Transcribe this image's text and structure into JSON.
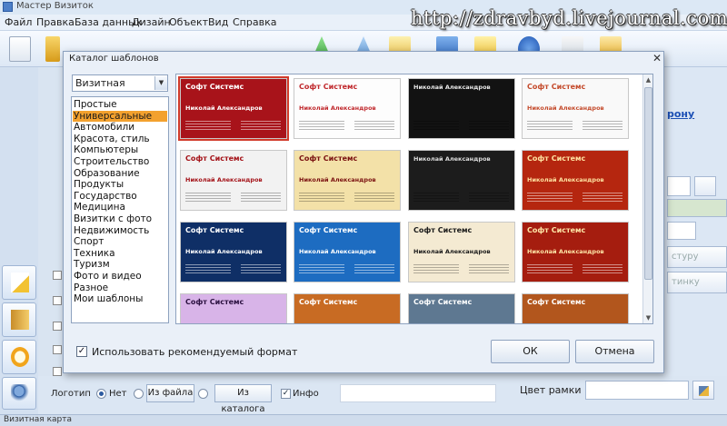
{
  "app": {
    "title": "Мастер Визиток",
    "watermark": "http://zdravbyd.livejournal.com"
  },
  "menu": [
    "Файл",
    "Правка",
    "База данных",
    "Дизайн",
    "Объект",
    "Вид",
    "Справка"
  ],
  "right_panel": {
    "link_fragment": "рону",
    "button1_fragment": "стуру",
    "button2_fragment": "тинку",
    "frame_color_label": "Цвет рамки"
  },
  "bottom": {
    "logo_label": "Логотип",
    "option_none": "Нет",
    "option_file": "Из файла",
    "option_catalog": "Из каталога",
    "info_label": "Инфо"
  },
  "status": "Визитная карта",
  "dialog": {
    "title": "Каталог шаблонов",
    "close_glyph": "✕",
    "selected_category": "Визитная",
    "categories": [
      "Простые",
      "Универсальные",
      "Автомобили",
      "Красота, стиль",
      "Компьютеры",
      "Строительство",
      "Образование",
      "Продукты",
      "Государство",
      "Медицина",
      "Визитки с фото",
      "Недвижимость",
      "Спорт",
      "Техника",
      "Туризм",
      "Фото и видео",
      "Разное",
      "Мои шаблоны"
    ],
    "selected_index": 1,
    "use_format_label": "Использовать рекомендуемый формат",
    "use_format_checked": true,
    "ok_label": "ОК",
    "cancel_label": "Отмена"
  },
  "templates": [
    {
      "company": "Софт Системс",
      "person": "Николай Александров",
      "bg": "#a8131a",
      "fg": "#ffffff",
      "selected": true
    },
    {
      "company": "Софт Системс",
      "person": "Николай Александров",
      "bg": "#fdfdfd",
      "fg": "#c0282c",
      "selected": false
    },
    {
      "company": "",
      "person": "Николай Александров",
      "bg": "#121212",
      "fg": "#e9e9e9",
      "selected": false
    },
    {
      "company": "Софт Системс",
      "person": "Николай Александров",
      "bg": "#f9f9f9",
      "fg": "#c44a2b",
      "selected": false
    },
    {
      "company": "Софт Системс",
      "person": "Николай Александров",
      "bg": "#f2f2f2",
      "fg": "#a41218",
      "selected": false
    },
    {
      "company": "Софт Системс",
      "person": "Николай Александров",
      "bg": "#f3e1a8",
      "fg": "#7a1010",
      "selected": false
    },
    {
      "company": "",
      "person": "Николай Александров",
      "bg": "#1c1c1c",
      "fg": "#dddddd",
      "selected": false
    },
    {
      "company": "Софт Системс",
      "person": "Николай Александров",
      "bg": "#b5260f",
      "fg": "#ffe2a0",
      "selected": false
    },
    {
      "company": "Софт Системс",
      "person": "Николай Александров",
      "bg": "#0f2f66",
      "fg": "#ffffff",
      "selected": false
    },
    {
      "company": "Софт Системс",
      "person": "Николай Александров",
      "bg": "#1d6cc1",
      "fg": "#ffffff",
      "selected": false
    },
    {
      "company": "Софт Системс",
      "person": "Николай Александров",
      "bg": "#f4ead2",
      "fg": "#1a1a1a",
      "selected": false
    },
    {
      "company": "Софт Системс",
      "person": "Николай Александров",
      "bg": "#a51d0f",
      "fg": "#ffe7a8",
      "selected": false
    },
    {
      "company": "Софт Системс",
      "person": "",
      "bg": "#d8b4e8",
      "fg": "#2b1140",
      "selected": false
    },
    {
      "company": "Софт Системс",
      "person": "",
      "bg": "#c86b23",
      "fg": "#ffffff",
      "selected": false
    },
    {
      "company": "Софт Системс",
      "person": "",
      "bg": "#5e7891",
      "fg": "#ffffff",
      "selected": false
    },
    {
      "company": "Софт Системс",
      "person": "",
      "bg": "#b2561d",
      "fg": "#ffffff",
      "selected": false
    }
  ]
}
